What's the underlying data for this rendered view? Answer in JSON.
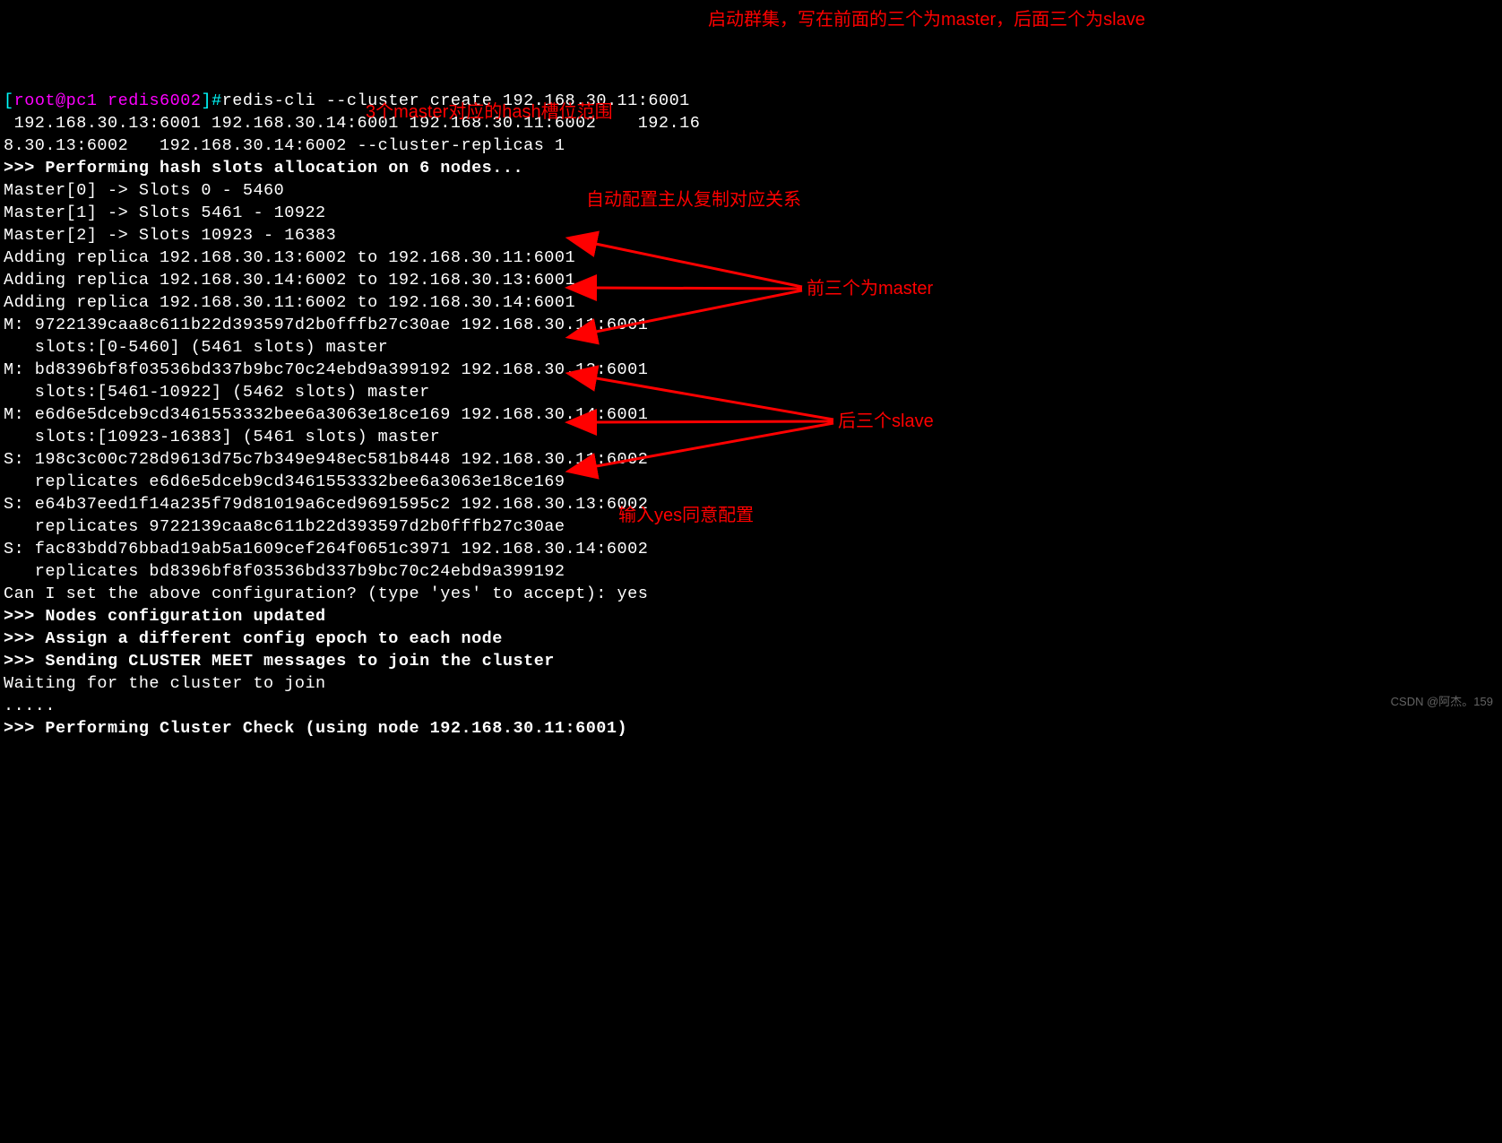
{
  "prompt_user": "[root@pc1 redis6002]#",
  "command": "redis-cli --cluster create 192.168.30.11:6001  192.168.30.13:6001 192.168.30.14:6001 192.168.30.11:6002    192.168.30.13:6002   192.168.30.14:6002 --cluster-replicas 1",
  "lines": {
    "l1": ">>> Performing hash slots allocation on 6 nodes...",
    "l2": "Master[0] -> Slots 0 - 5460",
    "l3": "Master[1] -> Slots 5461 - 10922",
    "l4": "Master[2] -> Slots 10923 - 16383",
    "l5": "Adding replica 192.168.30.13:6002 to 192.168.30.11:6001",
    "l6": "Adding replica 192.168.30.14:6002 to 192.168.30.13:6001",
    "l7": "Adding replica 192.168.30.11:6002 to 192.168.30.14:6001",
    "l8": "M: 9722139caa8c611b22d393597d2b0fffb27c30ae 192.168.30.11:6001",
    "l9": "   slots:[0-5460] (5461 slots) master",
    "l10": "M: bd8396bf8f03536bd337b9bc70c24ebd9a399192 192.168.30.13:6001",
    "l11": "   slots:[5461-10922] (5462 slots) master",
    "l12": "M: e6d6e5dceb9cd3461553332bee6a3063e18ce169 192.168.30.14:6001",
    "l13": "   slots:[10923-16383] (5461 slots) master",
    "l14": "S: 198c3c00c728d9613d75c7b349e948ec581b8448 192.168.30.11:6002",
    "l15": "   replicates e6d6e5dceb9cd3461553332bee6a3063e18ce169",
    "l16": "S: e64b37eed1f14a235f79d81019a6ced9691595c2 192.168.30.13:6002",
    "l17": "   replicates 9722139caa8c611b22d393597d2b0fffb27c30ae",
    "l18": "S: fac83bdd76bbad19ab5a1609cef264f0651c3971 192.168.30.14:6002",
    "l19": "   replicates bd8396bf8f03536bd337b9bc70c24ebd9a399192",
    "l20": "Can I set the above configuration? (type 'yes' to accept): yes",
    "l21": ">>> Nodes configuration updated",
    "l22": ">>> Assign a different config epoch to each node",
    "l23": ">>> Sending CLUSTER MEET messages to join the cluster",
    "l24": "Waiting for the cluster to join",
    "l25": ".....",
    "l26": ">>> Performing Cluster Check (using node 192.168.30.11:6001)"
  },
  "annotations": {
    "a1": "启动群集，写在前面的三个为master，后面三个为slave",
    "a2": "3个master对应的hash槽位范围",
    "a3": "自动配置主从复制对应关系",
    "a4": "前三个为master",
    "a5": "后三个slave",
    "a6": "输入yes同意配置"
  },
  "watermark": "CSDN @阿杰。159"
}
